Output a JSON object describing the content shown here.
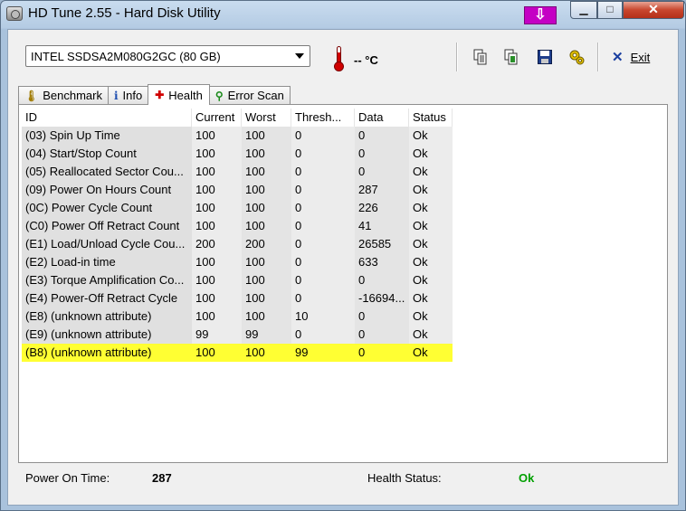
{
  "window": {
    "title": "HD Tune 2.55 - Hard Disk Utility",
    "caption_buttons": {
      "minimize": "▁",
      "maximize": "□",
      "close": "✕"
    },
    "badge_glyph": "⇩"
  },
  "toolbar": {
    "drive": "INTEL SSDSA2M080G2GC (80 GB)",
    "temperature": "-- °C",
    "exit_label": "Exit",
    "buttons": [
      "copy-text-icon",
      "copy-image-icon",
      "save-icon",
      "options-icon"
    ]
  },
  "tabs": [
    {
      "label": "Benchmark",
      "icon": "benchmark-icon",
      "glyph": "🌡"
    },
    {
      "label": "Info",
      "icon": "info-icon",
      "glyph": "i"
    },
    {
      "label": "Health",
      "icon": "health-icon",
      "glyph": "✚"
    },
    {
      "label": "Error Scan",
      "icon": "error-scan-icon",
      "glyph": "⚲"
    }
  ],
  "active_tab": "Health",
  "table": {
    "columns": [
      "ID",
      "Current",
      "Worst",
      "Thresh...",
      "Data",
      "Status"
    ],
    "rows": [
      {
        "id": "(03) Spin Up Time",
        "current": "100",
        "worst": "100",
        "thresh": "0",
        "data": "0",
        "status": "Ok"
      },
      {
        "id": "(04) Start/Stop Count",
        "current": "100",
        "worst": "100",
        "thresh": "0",
        "data": "0",
        "status": "Ok"
      },
      {
        "id": "(05) Reallocated Sector Cou...",
        "current": "100",
        "worst": "100",
        "thresh": "0",
        "data": "0",
        "status": "Ok"
      },
      {
        "id": "(09) Power On Hours Count",
        "current": "100",
        "worst": "100",
        "thresh": "0",
        "data": "287",
        "status": "Ok"
      },
      {
        "id": "(0C) Power Cycle Count",
        "current": "100",
        "worst": "100",
        "thresh": "0",
        "data": "226",
        "status": "Ok"
      },
      {
        "id": "(C0) Power Off Retract Count",
        "current": "100",
        "worst": "100",
        "thresh": "0",
        "data": "41",
        "status": "Ok"
      },
      {
        "id": "(E1) Load/Unload Cycle Cou...",
        "current": "200",
        "worst": "200",
        "thresh": "0",
        "data": "26585",
        "status": "Ok"
      },
      {
        "id": "(E2) Load-in time",
        "current": "100",
        "worst": "100",
        "thresh": "0",
        "data": "633",
        "status": "Ok"
      },
      {
        "id": "(E3) Torque Amplification Co...",
        "current": "100",
        "worst": "100",
        "thresh": "0",
        "data": "0",
        "status": "Ok"
      },
      {
        "id": "(E4) Power-Off Retract Cycle",
        "current": "100",
        "worst": "100",
        "thresh": "0",
        "data": "-16694...",
        "status": "Ok"
      },
      {
        "id": "(E8) (unknown attribute)",
        "current": "100",
        "worst": "100",
        "thresh": "10",
        "data": "0",
        "status": "Ok"
      },
      {
        "id": "(E9) (unknown attribute)",
        "current": "99",
        "worst": "99",
        "thresh": "0",
        "data": "0",
        "status": "Ok"
      },
      {
        "id": "(B8) (unknown attribute)",
        "current": "100",
        "worst": "100",
        "thresh": "99",
        "data": "0",
        "status": "Ok"
      }
    ],
    "highlighted_row": "(B8) (unknown attribute)",
    "highlight_color": "#ffff33"
  },
  "footer": {
    "power_on_label": "Power On Time:",
    "power_on_value": "287",
    "health_label": "Health Status:",
    "health_value": "Ok",
    "health_color": "#00a000"
  }
}
